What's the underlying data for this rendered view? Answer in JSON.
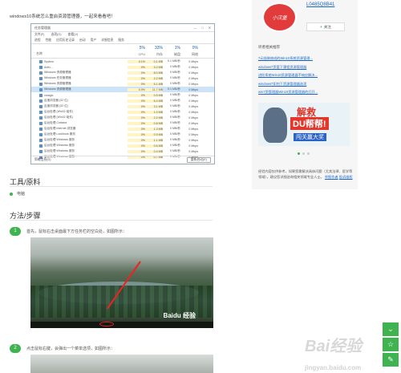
{
  "intro": "windows10系统怎么重启资源管理器，一起来看看吧！",
  "task_manager": {
    "title": "任务管理器",
    "window_buttons": [
      "—",
      "□",
      "✕"
    ],
    "menu": [
      "文件(F)",
      "选项(O)",
      "查看(V)"
    ],
    "tabs": [
      "进程",
      "性能",
      "应用历史记录",
      "启动",
      "用户",
      "详细信息",
      "服务"
    ],
    "col_name": "名称",
    "columns": [
      {
        "pct": "5%",
        "label": "CPU"
      },
      {
        "pct": "33%",
        "label": "内存"
      },
      {
        "pct": "1%",
        "label": "磁盘"
      },
      {
        "pct": "0%",
        "label": "网络"
      }
    ],
    "rows": [
      {
        "name": "System",
        "cpu": "0.1%",
        "mem": "0.1 MB",
        "disk": "0.1 MB/秒",
        "net": "0 Mbps"
      },
      {
        "name": "Antiv...",
        "cpu": "0%",
        "mem": "3.2 MB",
        "disk": "0 MB/秒",
        "net": "0 Mbps"
      },
      {
        "name": "Windows 资源管理器",
        "cpu": "0%",
        "mem": "8.0 MB",
        "disk": "0 MB/秒",
        "net": "0 Mbps"
      },
      {
        "name": "Windows 任务管理器",
        "cpu": "0%",
        "mem": "2.2 MB",
        "disk": "0 MB/秒",
        "net": "0 Mbps"
      },
      {
        "name": "Windows 资源管理器",
        "cpu": "0%",
        "mem": "5.1 MB",
        "disk": "0 MB/秒",
        "net": "0 Mbps"
      },
      {
        "name": "Windows 资源管理器",
        "cpu": "0.9%",
        "mem": "11.7 MB",
        "disk": "0.1 MB/秒",
        "net": "0 Mbps",
        "selected": true
      },
      {
        "name": "xmagic",
        "cpu": "0%",
        "mem": "0.5 MB",
        "disk": "0 MB/秒",
        "net": "0 Mbps"
      },
      {
        "name": "百度浏览器 (32 位)",
        "cpu": "0%",
        "mem": "6.4 MB",
        "disk": "0 MB/秒",
        "net": "0 Mbps"
      },
      {
        "name": "百度浏览器 (32 位)",
        "cpu": "0%",
        "mem": "3.1 MB",
        "disk": "0 MB/秒",
        "net": "0 Mbps"
      },
      {
        "name": "后台处理 (Win32 组件)",
        "cpu": "0%",
        "mem": "1.0 MB",
        "disk": "0 MB/秒",
        "net": "0 Mbps"
      },
      {
        "name": "后台处理 (Win32 组件)",
        "cpu": "0%",
        "mem": "2.2 MB",
        "disk": "0 MB/秒",
        "net": "0 Mbps"
      },
      {
        "name": "后台处理 Cortana",
        "cpu": "0%",
        "mem": "0.8 MB",
        "disk": "0 MB/秒",
        "net": "0 Mbps"
      },
      {
        "name": "后台处理 Internet 浏览器",
        "cpu": "0%",
        "mem": "1.3 MB",
        "disk": "0 MB/秒",
        "net": "0 Mbps"
      },
      {
        "name": "后台处理 Lockbook 服务",
        "cpu": "0%",
        "mem": "0.9 MB",
        "disk": "0 MB/秒",
        "net": "0 Mbps"
      },
      {
        "name": "后台处理 Windows 服务",
        "cpu": "0%",
        "mem": "1.1 MB",
        "disk": "0 MB/秒",
        "net": "0 Mbps"
      },
      {
        "name": "后台处理 Windows 服务",
        "cpu": "0%",
        "mem": "0.6 MB",
        "disk": "0 MB/秒",
        "net": "0 Mbps"
      },
      {
        "name": "后台处理 Windows 服务",
        "cpu": "0%",
        "mem": "0.4 MB",
        "disk": "0 MB/秒",
        "net": "0 Mbps"
      },
      {
        "name": "后台处理 Windows 服务",
        "cpu": "0%",
        "mem": "0.7 MB",
        "disk": "0 MB/秒",
        "net": "0 Mbps"
      }
    ],
    "fewer_details": "简略信息(D)",
    "end_task": "重新启动(E)"
  },
  "tools_title": "工具/原料",
  "tools_item": "电脑",
  "steps_title": "方法/步骤",
  "steps": [
    {
      "num": "1",
      "text": "首先，鼠标右击桌面最下方任务栏的空白处，如图所示："
    },
    {
      "num": "2",
      "text": "点击鼠标右键，会弹出一个菜单选项，如图所示："
    }
  ],
  "photo_watermark": "Baidu 经验",
  "sidebar": {
    "avatar_text": "小汉堡",
    "username": "L0485Q8B41",
    "add_label": "关注",
    "related_title": "听者相关推荐",
    "links": [
      "7元钱装修成的Win10系统资源管理...",
      "windows7资管下课程资源管理器",
      "进阶系统Win10资源管理器不响应解决...",
      "windows7如何下资源管理器选项",
      "win7资管理器Win10资源管理器的打开..."
    ],
    "ad_big": "解救",
    "ad_mid": "DU帮帮!",
    "ad_band": "闯关赢大奖",
    "note_pre": "经验内容仅供参考，如果您需解决具体问题（尤其法律、医学等领域），建议您详细咨询相关领域专业人士。",
    "note_link": "举报作者",
    "note_post": "投诉维权"
  },
  "float_icons": [
    "share-icon",
    "star-icon",
    "edit-icon"
  ],
  "brand": "Bai经验",
  "brand_sub": "jingyan.baidu.com"
}
